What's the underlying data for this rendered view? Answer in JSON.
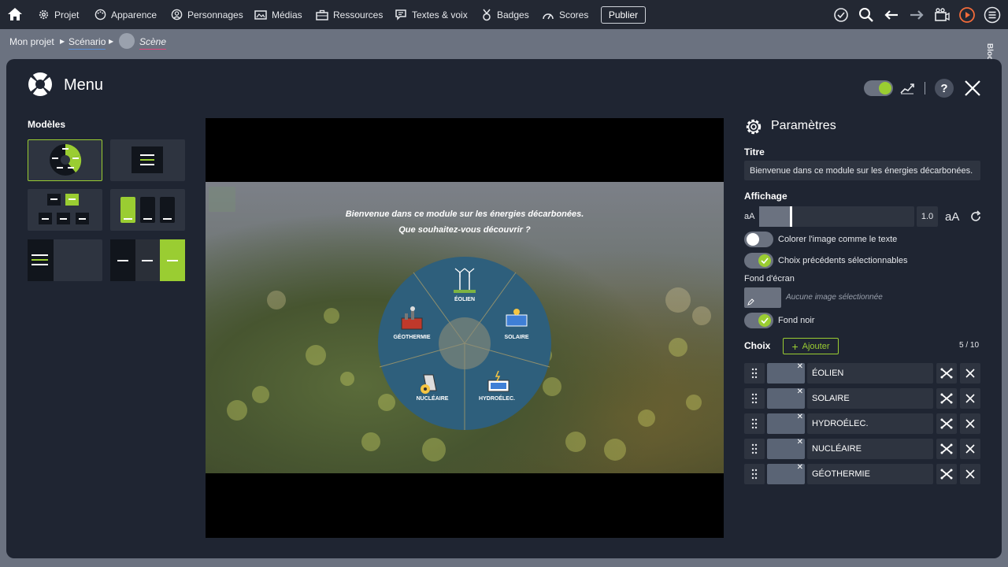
{
  "nav": {
    "items": [
      {
        "label": "Projet",
        "icon": "gear-icon"
      },
      {
        "label": "Apparence",
        "icon": "palette-icon"
      },
      {
        "label": "Personnages",
        "icon": "person-icon"
      },
      {
        "label": "Médias",
        "icon": "image-icon"
      },
      {
        "label": "Ressources",
        "icon": "briefcase-icon"
      },
      {
        "label": "Textes & voix",
        "icon": "speech-icon"
      },
      {
        "label": "Badges",
        "icon": "badge-icon"
      },
      {
        "label": "Scores",
        "icon": "gauge-icon"
      }
    ],
    "publish_label": "Publier"
  },
  "breadcrumb": {
    "project": "Mon projet",
    "scenario": "Scénario",
    "scene": "Scène"
  },
  "modal": {
    "title": "Menu",
    "models_label": "Modèles",
    "accent": "#9acd32"
  },
  "stage": {
    "welcome_line1": "Bienvenue dans ce module sur les énergies décarbonées.",
    "welcome_line2": "Que souhaitez-vous découvrir ?",
    "wheel_items": [
      "ÉOLIEN",
      "SOLAIRE",
      "HYDROÉLEC.",
      "NUCLÉAIRE",
      "GÉOTHERMIE"
    ],
    "wheel_color": "#2e5f7c"
  },
  "params": {
    "title": "Paramètres",
    "titre_label": "Titre",
    "titre_value": "Bienvenue dans ce module sur les énergies décarbonées.",
    "affichage_label": "Affichage",
    "size_small": "aA",
    "size_value": "1.0",
    "size_large": "aA",
    "toggle_color_text": "Colorer l'image comme le texte",
    "toggle_prev_choices": "Choix précédents sélectionnables",
    "fond_label": "Fond d'écran",
    "no_image": "Aucune image sélectionnée",
    "fond_noir": "Fond noir",
    "choix_label": "Choix",
    "add_label": "Ajouter",
    "count": "5 / 10",
    "choices": [
      "ÉOLIEN",
      "SOLAIRE",
      "HYDROÉLEC.",
      "NUCLÉAIRE",
      "GÉOTHERMIE"
    ]
  },
  "side_tab": "Bloc"
}
